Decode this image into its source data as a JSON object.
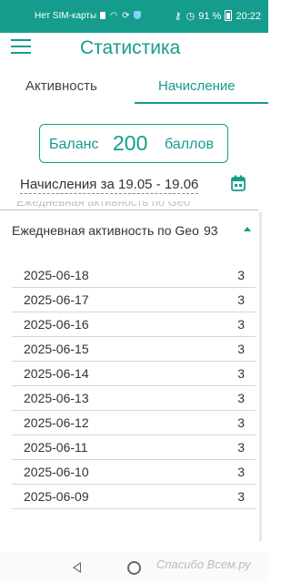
{
  "status_bar": {
    "carrier": "Нет SIM-карты",
    "battery": "91 %",
    "time": "20:22"
  },
  "app_bar": {
    "title": "Статистика",
    "menu_icon": "hamburger-icon"
  },
  "tabs": [
    {
      "label": "Активность",
      "selected": false
    },
    {
      "label": "Начисление",
      "selected": true
    }
  ],
  "accent_color": "#159c8c",
  "balance": {
    "label": "Баланс",
    "value": "200",
    "unit": "баллов"
  },
  "period": {
    "label": "Начисления за 19.05 - 19.06",
    "icon": "calendar-icon"
  },
  "section": {
    "title": "Ежедневная активность по Geo",
    "count": "93",
    "expanded": true,
    "rows": [
      {
        "date": "2025-06-18",
        "value": "3"
      },
      {
        "date": "2025-06-17",
        "value": "3"
      },
      {
        "date": "2025-06-16",
        "value": "3"
      },
      {
        "date": "2025-06-15",
        "value": "3"
      },
      {
        "date": "2025-06-14",
        "value": "3"
      },
      {
        "date": "2025-06-13",
        "value": "3"
      },
      {
        "date": "2025-06-12",
        "value": "3"
      },
      {
        "date": "2025-06-11",
        "value": "3"
      },
      {
        "date": "2025-06-10",
        "value": "3"
      },
      {
        "date": "2025-06-09",
        "value": "3"
      }
    ]
  },
  "watermark": "Спасибо Всем.ру"
}
